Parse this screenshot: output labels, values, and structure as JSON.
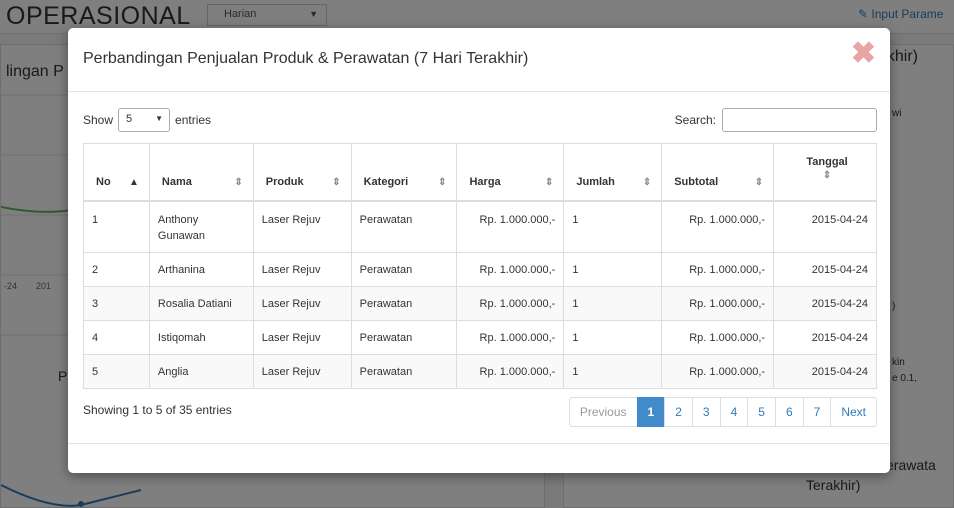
{
  "background": {
    "app_title": "OPERASIONAL",
    "period_select": "Harian",
    "input_param_link": "Input Parame",
    "left_panel_title": "lingan P",
    "right_panel_title": "akhir)",
    "right_text_1": "wi",
    "right_text_2": ")",
    "right_text_3": "kin",
    "right_text_4": "e 0.1,",
    "axis_label_1": "-24",
    "axis_label_2": "201",
    "left_letter": "P",
    "bottom_right_line1": "erawata",
    "bottom_right_line2": "Terakhir)"
  },
  "modal": {
    "title": "Perbandingan Penjualan Produk & Perawatan (7 Hari Terakhir)",
    "close_symbol": "✖",
    "show_label": "Show",
    "entries_value": "5",
    "entries_label": "entries",
    "search_label": "Search:",
    "search_value": "",
    "columns": [
      "No",
      "Nama",
      "Produk",
      "Kategori",
      "Harga",
      "Jumlah",
      "Subtotal",
      "Tanggal"
    ],
    "rows": [
      {
        "no": "1",
        "nama": "Anthony Gunawan",
        "produk": "Laser Rejuv",
        "kategori": "Perawatan",
        "harga": "Rp. 1.000.000,-",
        "jumlah": "1",
        "subtotal": "Rp. 1.000.000,-",
        "tanggal": "2015-04-24"
      },
      {
        "no": "2",
        "nama": "Arthanina",
        "produk": "Laser Rejuv",
        "kategori": "Perawatan",
        "harga": "Rp. 1.000.000,-",
        "jumlah": "1",
        "subtotal": "Rp. 1.000.000,-",
        "tanggal": "2015-04-24"
      },
      {
        "no": "3",
        "nama": "Rosalia Datiani",
        "produk": "Laser Rejuv",
        "kategori": "Perawatan",
        "harga": "Rp. 1.000.000,-",
        "jumlah": "1",
        "subtotal": "Rp. 1.000.000,-",
        "tanggal": "2015-04-24"
      },
      {
        "no": "4",
        "nama": "Istiqomah",
        "produk": "Laser Rejuv",
        "kategori": "Perawatan",
        "harga": "Rp. 1.000.000,-",
        "jumlah": "1",
        "subtotal": "Rp. 1.000.000,-",
        "tanggal": "2015-04-24"
      },
      {
        "no": "5",
        "nama": "Anglia",
        "produk": "Laser Rejuv",
        "kategori": "Perawatan",
        "harga": "Rp. 1.000.000,-",
        "jumlah": "1",
        "subtotal": "Rp. 1.000.000,-",
        "tanggal": "2015-04-24"
      }
    ],
    "info": "Showing 1 to 5 of 35 entries",
    "pagination": {
      "previous": "Previous",
      "pages": [
        "1",
        "2",
        "3",
        "4",
        "5",
        "6",
        "7"
      ],
      "active_page": "1",
      "next": "Next"
    }
  },
  "colors": {
    "active_page": "#428bca",
    "link": "#337ab7",
    "close": "#e8a5a5"
  }
}
